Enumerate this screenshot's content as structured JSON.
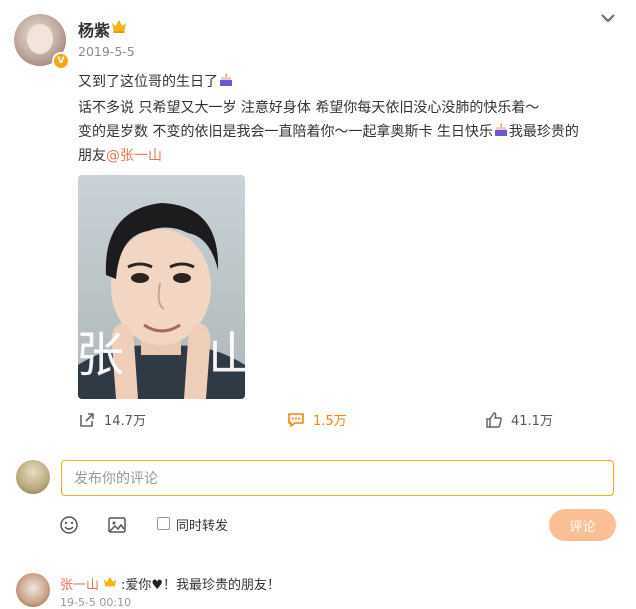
{
  "post": {
    "author": "杨紫",
    "date": "2019-5-5",
    "lines": {
      "line1": "又到了这位哥的生日了",
      "line2": "话不多说 只希望又大一岁 注意好身体 希望你每天依旧没心没肺的快乐着～",
      "line3a": "变的是岁数 不变的依旧是我会一直陪着你～一起拿奥斯卡 生日快乐",
      "line3b": "我最珍贵的",
      "line4": "朋友",
      "mention": "@张一山"
    },
    "photo": {
      "left_char": "张",
      "right_char": "山"
    },
    "icons": {
      "author_badge": "crown-icon",
      "verified": "verified-v-badge",
      "emoji": "cake-icon",
      "menu": "chevron-down-icon"
    }
  },
  "actions": {
    "repost": {
      "icon": "share-icon",
      "count": "14.7万"
    },
    "comment": {
      "icon": "comment-icon",
      "count": "1.5万"
    },
    "like": {
      "icon": "thumbs-up-icon",
      "count": "41.1万"
    }
  },
  "composer": {
    "placeholder": "发布你的评论",
    "repost_label": "同时转发",
    "submit_label": "评论",
    "tools": [
      "emoji-icon",
      "image-icon"
    ]
  },
  "comment": {
    "author": "张一山",
    "text_a": ":爱你",
    "text_b": "！我最珍贵的朋友！",
    "meta": "19-5-5 00:10"
  },
  "colors": {
    "accent": "#ff8200",
    "mention": "#eb7350",
    "input_border": "#f7a81c",
    "submit_bg": "#fbbf96",
    "muted": "#8c8c8c"
  }
}
